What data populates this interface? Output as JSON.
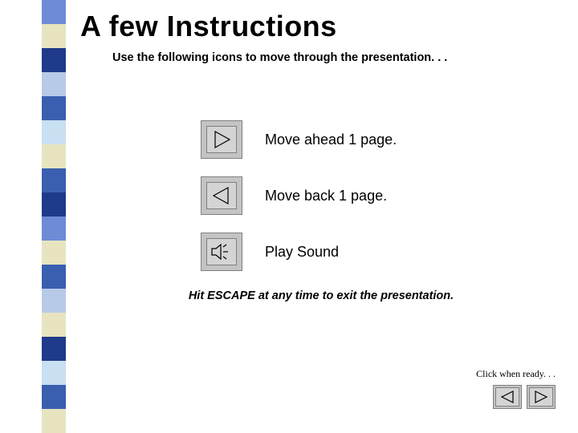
{
  "sidebar_colors": [
    "#6e8bd6",
    "#e8e4c0",
    "#1f3a8a",
    "#b7cae8",
    "#3a5fb0",
    "#c9dff2",
    "#e8e4c0",
    "#3a5fb0",
    "#1f3a8a",
    "#6e8bd6",
    "#e8e4c0",
    "#3a5fb0",
    "#b7cae8",
    "#e8e4c0",
    "#1f3a8a",
    "#c9dff2",
    "#3a5fb0",
    "#e8e4c0"
  ],
  "title": "A few Instructions",
  "subtitle": "Use the following icons to move through the presentation. . .",
  "items": [
    {
      "icon": "play-forward",
      "label": "Move ahead 1 page."
    },
    {
      "icon": "play-back",
      "label": "Move back 1 page."
    },
    {
      "icon": "sound",
      "label": "Play Sound"
    }
  ],
  "footer": "Hit ESCAPE at any time to exit the presentation.",
  "ready": "Click when ready. . .",
  "nav": {
    "back_icon": "play-back",
    "forward_icon": "play-forward"
  }
}
